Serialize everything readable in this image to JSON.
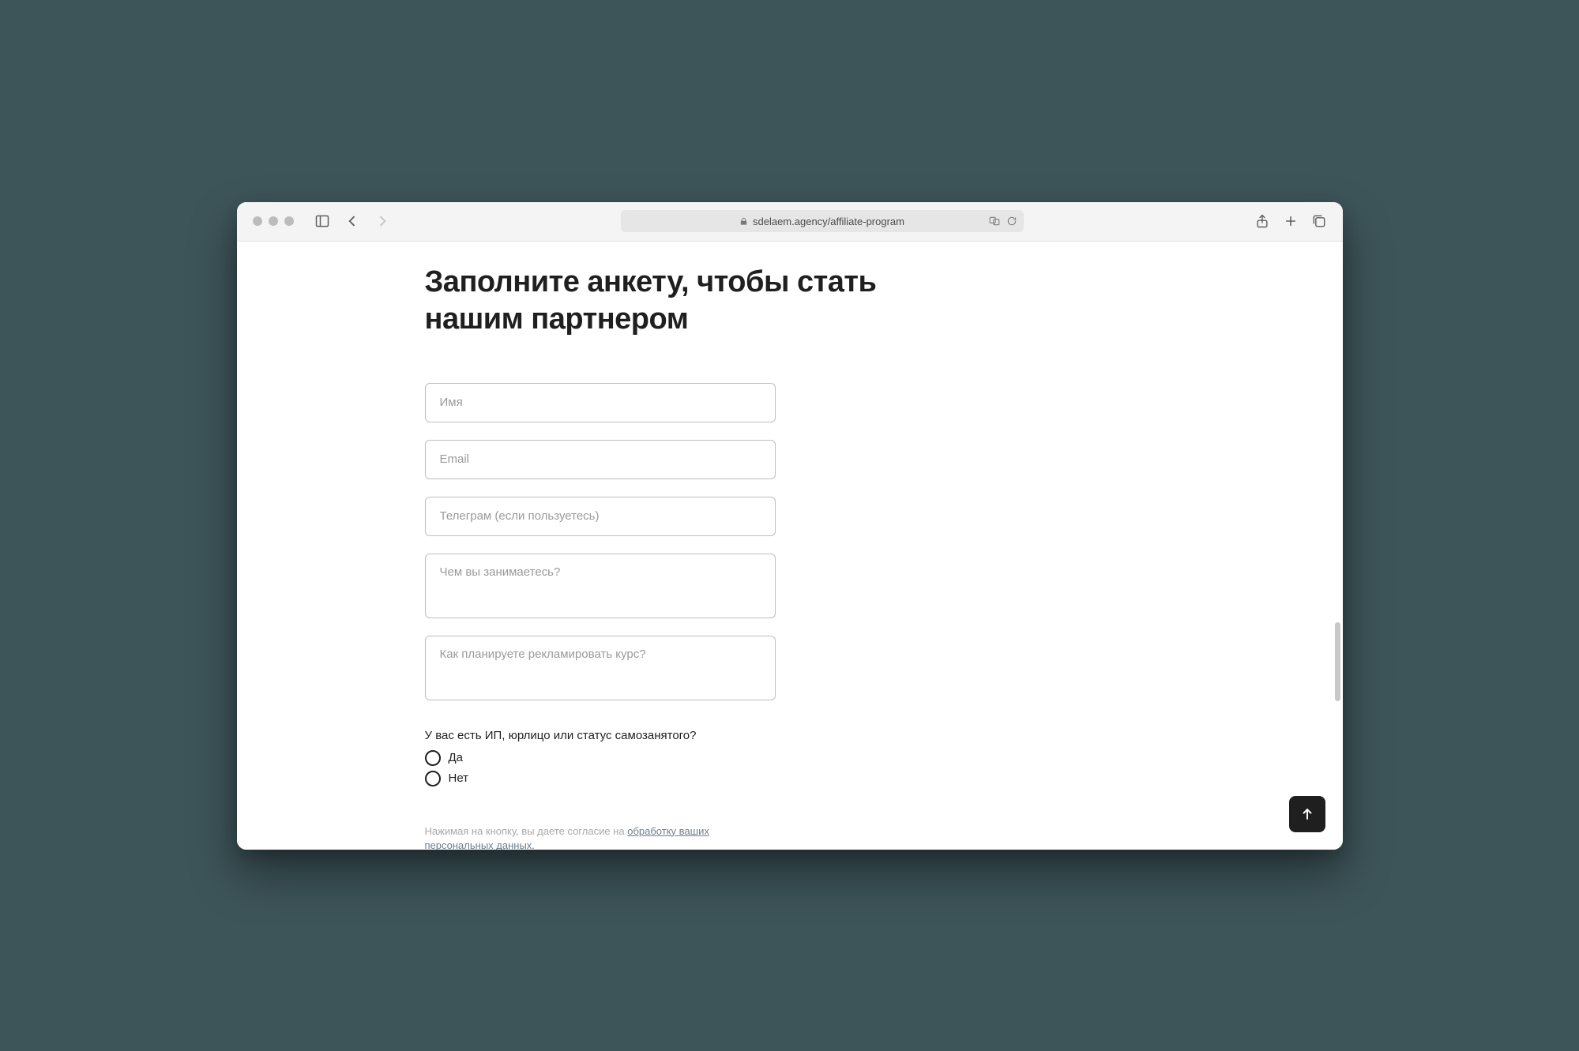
{
  "browser": {
    "url": "sdelaem.agency/affiliate-program"
  },
  "page": {
    "title": "Заполните анкету, чтобы стать нашим партнером"
  },
  "form": {
    "name_placeholder": "Имя",
    "email_placeholder": "Email",
    "telegram_placeholder": "Телеграм (если пользуетесь)",
    "about_placeholder": "Чем вы занимаетесь?",
    "plan_placeholder": "Как планируете рекламировать курс?",
    "legal_question": "У вас есть ИП, юрлицо или статус самозанятого?",
    "radio_yes": "Да",
    "radio_no": "Нет",
    "consent_prefix": "Нажимая на кнопку, вы даете согласие на ",
    "consent_link": "обработку ваших персональных данных."
  }
}
